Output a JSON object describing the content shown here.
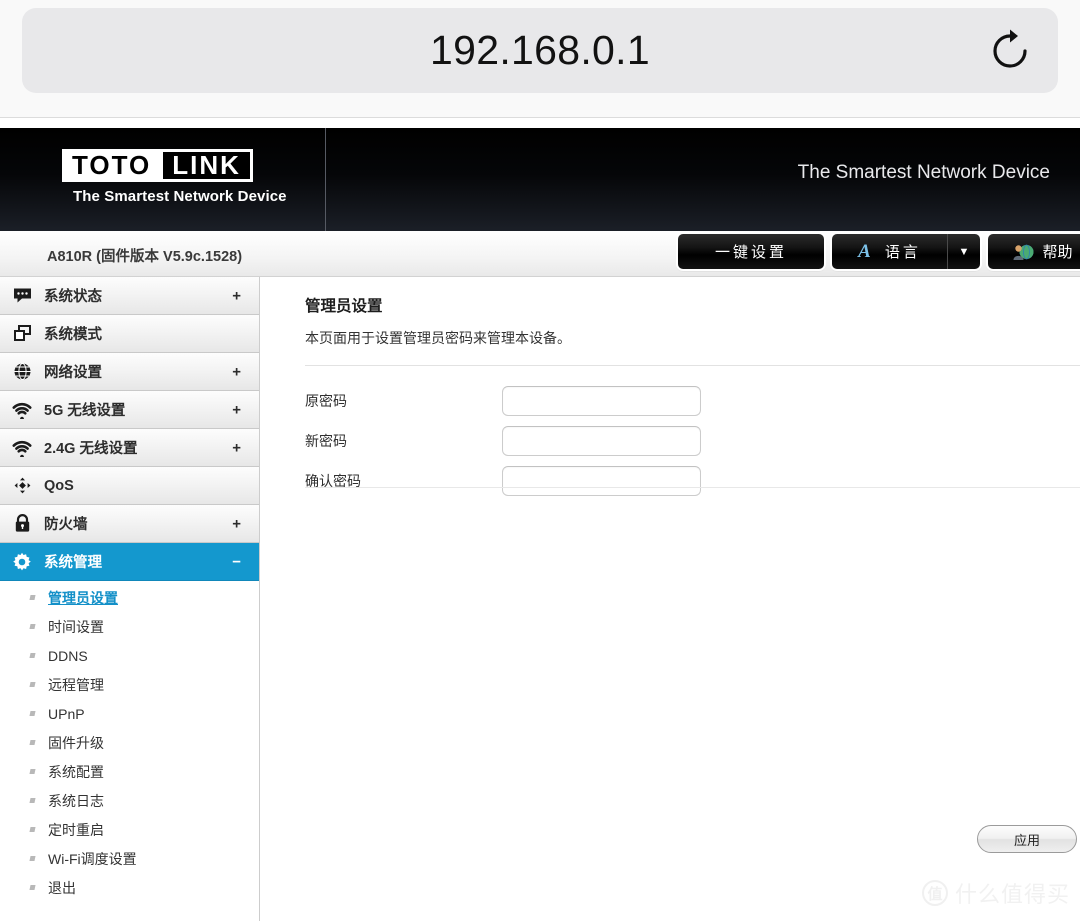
{
  "browser": {
    "url": "192.168.0.1",
    "reload_icon": "reload-icon"
  },
  "banner": {
    "logo_toto": "TOTO",
    "logo_link": "LINK",
    "logo_tagline": "The Smartest Network Device",
    "right_tagline": "The Smartest Network Device"
  },
  "subheader": {
    "model": "A810R (固件版本 V5.9c.1528)",
    "buttons": {
      "onekey_setup": "一键设置",
      "language_glyph": "A",
      "language": "语言",
      "language_arrow": "▼",
      "help": "帮助"
    }
  },
  "sidebar": {
    "items": [
      {
        "label": "系统状态",
        "icon": "chat-bubble-icon",
        "toggle": "+",
        "active": false
      },
      {
        "label": "系统模式",
        "icon": "windows-icon",
        "toggle": "",
        "active": false
      },
      {
        "label": "网络设置",
        "icon": "globe-icon",
        "toggle": "+",
        "active": false
      },
      {
        "label": "5G 无线设置",
        "icon": "wifi-icon",
        "toggle": "+",
        "active": false
      },
      {
        "label": "2.4G 无线设置",
        "icon": "wifi-icon",
        "toggle": "+",
        "active": false
      },
      {
        "label": "QoS",
        "icon": "diamond-arrows-icon",
        "toggle": "",
        "active": false
      },
      {
        "label": "防火墙",
        "icon": "lock-icon",
        "toggle": "+",
        "active": false
      },
      {
        "label": "系统管理",
        "icon": "gear-icon",
        "toggle": "−",
        "active": true
      }
    ],
    "submenu": [
      {
        "label": "管理员设置",
        "active": true
      },
      {
        "label": "时间设置",
        "active": false
      },
      {
        "label": "DDNS",
        "active": false
      },
      {
        "label": "远程管理",
        "active": false
      },
      {
        "label": "UPnP",
        "active": false
      },
      {
        "label": "固件升级",
        "active": false
      },
      {
        "label": "系统配置",
        "active": false
      },
      {
        "label": "系统日志",
        "active": false
      },
      {
        "label": "定时重启",
        "active": false
      },
      {
        "label": "Wi-Fi调度设置",
        "active": false
      },
      {
        "label": "退出",
        "active": false
      }
    ]
  },
  "main": {
    "title": "管理员设置",
    "description": "本页面用于设置管理员密码来管理本设备。",
    "fields": [
      {
        "label": "原密码",
        "value": "",
        "placeholder": ""
      },
      {
        "label": "新密码",
        "value": "",
        "placeholder": ""
      },
      {
        "label": "确认密码",
        "value": "",
        "placeholder": ""
      }
    ],
    "apply_label": "应用"
  },
  "watermark": {
    "mark": "值",
    "text": "什么值得买"
  },
  "colors": {
    "accent": "#1498ce",
    "link": "#1390c8",
    "banner": "#000000"
  }
}
